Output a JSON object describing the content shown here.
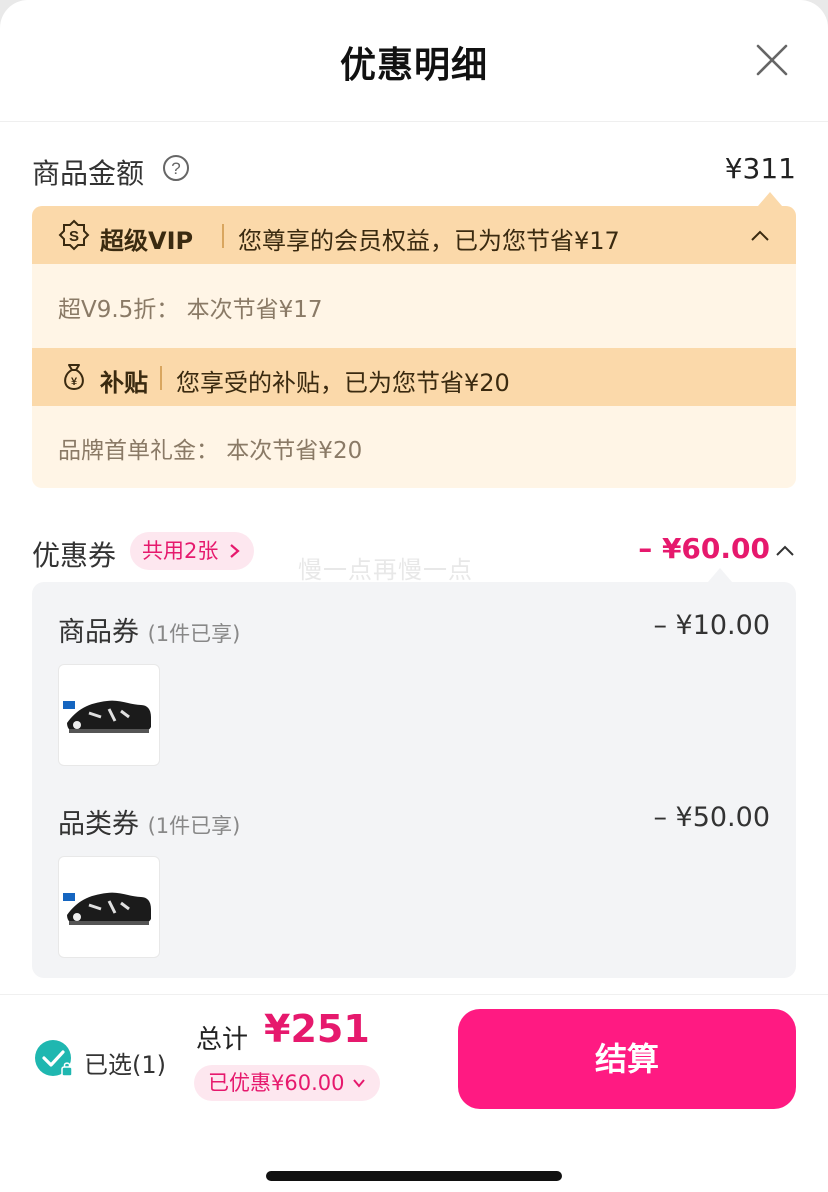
{
  "header": {
    "title": "优惠明细"
  },
  "goods": {
    "label": "商品金额",
    "amount": "¥311"
  },
  "vip": {
    "name": "超级VIP",
    "desc": "您尊享的会员权益，已为您节省¥17",
    "line": "超V9.5折：  本次节省¥17"
  },
  "subsidy": {
    "name": "补贴",
    "desc": "您享受的补贴，已为您节省¥20",
    "line": "品牌首单礼金：  本次节省¥20"
  },
  "coupons": {
    "label": "优惠券",
    "share": "共用2张",
    "total": "– ¥60.00",
    "items": [
      {
        "title": "商品券",
        "sub": "(1件已享)",
        "amount": "– ¥10.00"
      },
      {
        "title": "品类券",
        "sub": "(1件已享)",
        "amount": "– ¥50.00"
      }
    ]
  },
  "watermark": "慢一点再慢一点",
  "bottom": {
    "selected": "已选(1)",
    "total_label": "总计",
    "total_value": "¥251",
    "discount": "已优惠¥60.00",
    "checkout": "结算"
  },
  "colors": {
    "accent": "#ff1a82",
    "vip_band": "#fbd9aa",
    "benefit_bg": "#fff5e6",
    "check": "#1fb7b0"
  }
}
